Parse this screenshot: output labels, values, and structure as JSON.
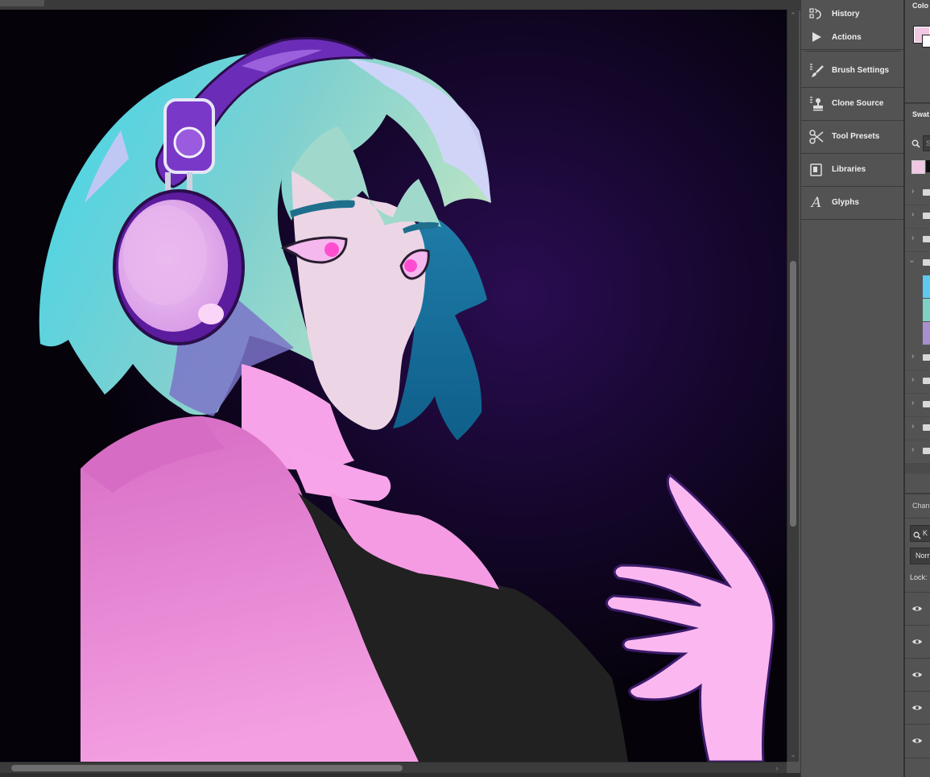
{
  "dock": {
    "items": [
      {
        "label": "History",
        "icon": "history-icon"
      },
      {
        "label": "Actions",
        "icon": "play-icon"
      },
      {
        "label": "Brush Settings",
        "icon": "brush-icon"
      },
      {
        "label": "Clone Source",
        "icon": "stamp-icon"
      },
      {
        "label": "Tool Presets",
        "icon": "tool-presets-icon"
      },
      {
        "label": "Libraries",
        "icon": "libraries-icon"
      },
      {
        "label": "Glyphs",
        "icon": "glyph-icon"
      }
    ]
  },
  "right_panel": {
    "color_title": "Colo",
    "swatches_title": "Swat",
    "swatch_search_placeholder": "S",
    "channels_title": "Chan",
    "layer_search_text": "K",
    "blend_mode": "Norr",
    "lock_label": "Lock:",
    "foreground_color": "#f0c8e2",
    "background_color": "#ffffff",
    "swatch_colors": [
      "#5ec8f0",
      "#7fd0c4",
      "#a98fcf"
    ]
  },
  "colors": {
    "panel_bg": "#535353",
    "canvas_bg": "#0b0512",
    "hair_cyan": "#44d4e6",
    "jacket_pink": "#e58fd6",
    "headphone_purple": "#7b2fc0"
  }
}
